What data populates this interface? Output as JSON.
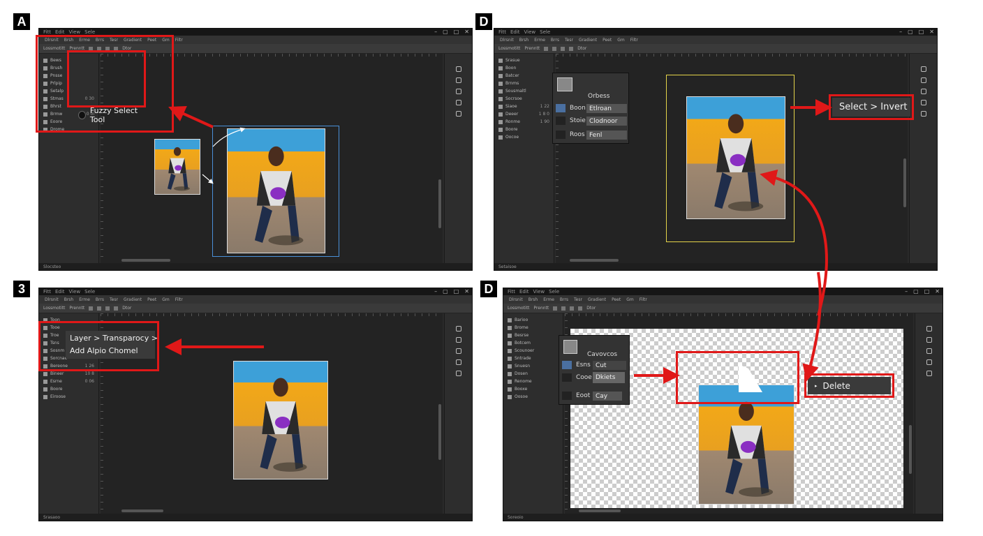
{
  "labels": {
    "p1": "A",
    "p2": "D",
    "p3": "3",
    "p4": "D"
  },
  "menu_items": [
    "Fitt",
    "Edit",
    "View",
    "Sele"
  ],
  "toolbar_items": [
    "Dlrsnit",
    "Brsh",
    "Erme",
    "Brrs",
    "Tesr",
    "Gradient",
    "Peet",
    "Gm",
    "Filtr"
  ],
  "option_items": [
    "Lossmotitt",
    "Prenntt",
    "Dtor"
  ],
  "panel1": {
    "tools": [
      {
        "label": "Bews",
        "value": ""
      },
      {
        "label": "Brush",
        "value": ""
      },
      {
        "label": "Pnsse",
        "value": ""
      },
      {
        "label": "Prlpip",
        "value": ""
      },
      {
        "label": "Setalp",
        "value": ""
      },
      {
        "label": "Stmas",
        "value": "0 30"
      },
      {
        "label": "Bhrst",
        "value": ""
      },
      {
        "label": "Brmw",
        "value": "0 0i"
      },
      {
        "label": "Eoore",
        "value": ""
      },
      {
        "label": "Drome",
        "value": ""
      }
    ],
    "callout": "Fuzzy Select Tool",
    "statusbar": "Slocsteo"
  },
  "panel2": {
    "tools": [
      {
        "label": "Srasue",
        "value": ""
      },
      {
        "label": "Boon",
        "value": ""
      },
      {
        "label": "Batcer",
        "value": ""
      },
      {
        "label": "Brnms",
        "value": ""
      },
      {
        "label": "Sousmaltl",
        "value": ""
      },
      {
        "label": "Socrsoe",
        "value": ""
      },
      {
        "label": "Siaoe",
        "value": "1 22"
      },
      {
        "label": "Deeer",
        "value": "1 8 0"
      },
      {
        "label": "Ronme",
        "value": "1 90"
      },
      {
        "label": "Boore",
        "value": ""
      },
      {
        "label": "Oocoe",
        "value": ""
      }
    ],
    "popup": {
      "title": "Orbess",
      "rows": [
        {
          "label": "Boon",
          "button": "Etlroan"
        },
        {
          "label": "Stoie",
          "button": "Clodnoor"
        },
        {
          "label": "Roos",
          "button": "Fenl"
        }
      ]
    },
    "callout": "Select > Invert",
    "statusbar": "Setaisoe"
  },
  "panel3": {
    "tools": [
      {
        "label": "Toon",
        "value": ""
      },
      {
        "label": "Tooe",
        "value": ""
      },
      {
        "label": "Troe",
        "value": ""
      },
      {
        "label": "Tsns",
        "value": ""
      },
      {
        "label": "Sosnm",
        "value": ""
      },
      {
        "label": "Sorcnae",
        "value": ""
      },
      {
        "label": "Bereone",
        "value": "1 26"
      },
      {
        "label": "Bineer",
        "value": "10 8"
      },
      {
        "label": "Esrne",
        "value": "0 06"
      },
      {
        "label": "Boore",
        "value": ""
      },
      {
        "label": "Eiroose",
        "value": ""
      }
    ],
    "callout_line1": "Layer > Transparocy >",
    "callout_line2": "Add Alpio Chomel",
    "statusbar": "Srasaoo"
  },
  "panel4": {
    "tools": [
      {
        "label": "Barioo",
        "value": ""
      },
      {
        "label": "Brome",
        "value": ""
      },
      {
        "label": "Besrse",
        "value": ""
      },
      {
        "label": "Botcem",
        "value": ""
      },
      {
        "label": "Scounoer",
        "value": ""
      },
      {
        "label": "Sntrade",
        "value": ""
      },
      {
        "label": "Snuesn",
        "value": ""
      },
      {
        "label": "Dosen",
        "value": ""
      },
      {
        "label": "Renome",
        "value": ""
      },
      {
        "label": "Booxe",
        "value": ""
      },
      {
        "label": "Oosoe",
        "value": ""
      }
    ],
    "popup": {
      "title": "Cavovcos",
      "rows": [
        {
          "label": "Esns",
          "button": "Cut"
        },
        {
          "label": "Cooe",
          "button": "Dkiets"
        },
        {
          "label": "Eoot",
          "button": "Cay"
        }
      ]
    },
    "callout": "Delete",
    "statusbar": "Soreoio"
  },
  "colors": {
    "accent_red": "#e01818",
    "selection_blue": "#4a90d9",
    "selection_yellow": "#e5d44a"
  }
}
